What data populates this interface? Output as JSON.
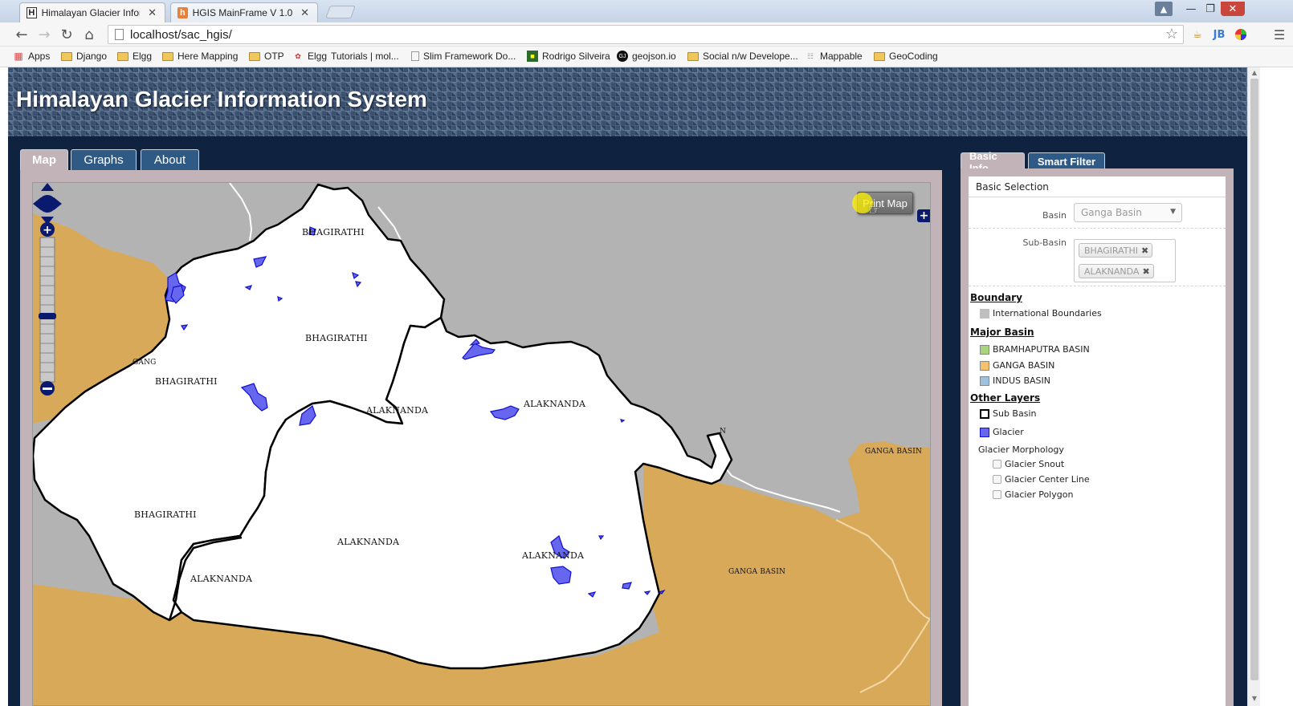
{
  "browser": {
    "tabs": [
      {
        "label": "Himalayan Glacier Inform",
        "favicon": "H",
        "active": true
      },
      {
        "label": "HGIS MainFrame V 1.0",
        "favicon": "h",
        "active": false
      }
    ],
    "url": "localhost/sac_hgis/",
    "bookmarks": [
      "Apps",
      "Django",
      "Elgg",
      "Here Mapping",
      "OTP",
      "Elgg",
      "Tutorials | mol...",
      "Slim Framework Do...",
      "Rodrigo Silveira",
      "geojson.io",
      "Social n/w Develope...",
      "Mappable",
      "GeoCoding"
    ]
  },
  "site": {
    "title": "Himalayan Glacier Information System",
    "tabs": {
      "map": "Map",
      "graphs": "Graphs",
      "about": "About"
    }
  },
  "map": {
    "print_button": "Print Map",
    "labels": {
      "bhagirathi_top": "BHAGIRATHI",
      "bhagirathi_mid": "BHAGIRATHI",
      "bhagirathi_left": "BHAGIRATHI",
      "bhagirathi_low": "BHAGIRATHI",
      "alaknanda_center": "ALAKNANDA",
      "alaknanda_right": "ALAKNANDA",
      "alaknanda_south": "ALAKNANDA",
      "alaknanda_glacier": "ALAKNANDA",
      "alaknanda_sw": "ALAKNANDA",
      "ganga_basin_ne": "GANGA BASIN",
      "ganga_basin_se": "GANGA BASIN",
      "ganga_cut": "GANG",
      "n_cut": "N"
    },
    "colors": {
      "basin": "#d9a95a",
      "international": "#b3b3b3",
      "subbasin": "#ffffff",
      "glacier_fill": "#6666ee",
      "glacier_stroke": "#1010cc"
    }
  },
  "side": {
    "tabs": {
      "basic_info": "Basic Info",
      "smart_filter": "Smart Filter"
    },
    "basic_selection": "Basic Selection",
    "basin_label": "Basin",
    "basin_value": "Ganga Basin",
    "subbasin_label": "Sub-Basin",
    "subbasin_chips": [
      "BHAGIRATHI",
      "ALAKNANDA"
    ],
    "boundary_head": "Boundary",
    "boundary_items": [
      "International Boundaries"
    ],
    "major_basin_head": "Major Basin",
    "major_basins": [
      {
        "label": "BRAMHAPUTRA BASIN",
        "color": "#a8d47a"
      },
      {
        "label": "GANGA BASIN",
        "color": "#f5c26b"
      },
      {
        "label": "INDUS BASIN",
        "color": "#9cc2e0"
      }
    ],
    "other_layers_head": "Other Layers",
    "other_layers": [
      "Sub Basin",
      "Glacier"
    ],
    "morphology_head": "Glacier Morphology",
    "morphology_items": [
      "Glacier Snout",
      "Glacier Center Line",
      "Glacier Polygon"
    ]
  }
}
